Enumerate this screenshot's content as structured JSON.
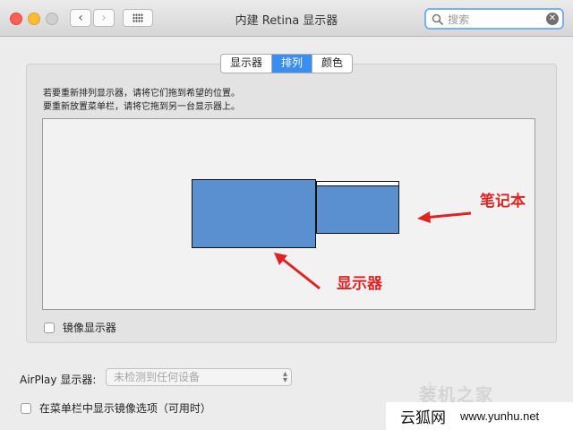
{
  "window": {
    "title": "内建 Retina 显示器"
  },
  "search": {
    "placeholder": "搜索"
  },
  "tabs": [
    {
      "label": "显示器"
    },
    {
      "label": "排列",
      "active": true
    },
    {
      "label": "颜色"
    }
  ],
  "instructions": {
    "line1": "若要重新排列显示器，请将它们拖到希望的位置。",
    "line2": "要重新放置菜单栏，请将它拖到另一台显示器上。"
  },
  "annotations": {
    "laptop": "笔记本",
    "display": "显示器"
  },
  "mirror_checkbox": {
    "label": "镜像显示器",
    "checked": false
  },
  "airplay": {
    "label": "AirPlay 显示器:",
    "selected": "未检测到任何设备"
  },
  "menu_option": {
    "label": "在菜单栏中显示镜像选项（可用时）",
    "checked": false
  },
  "watermark": {
    "text_faint": "装机之家",
    "text_cn": "云狐网",
    "text_url": "www.yunhu.net"
  },
  "colors": {
    "accent": "#3a8ef0",
    "display_fill": "#5a8fd0",
    "annotation": "#e02222"
  }
}
